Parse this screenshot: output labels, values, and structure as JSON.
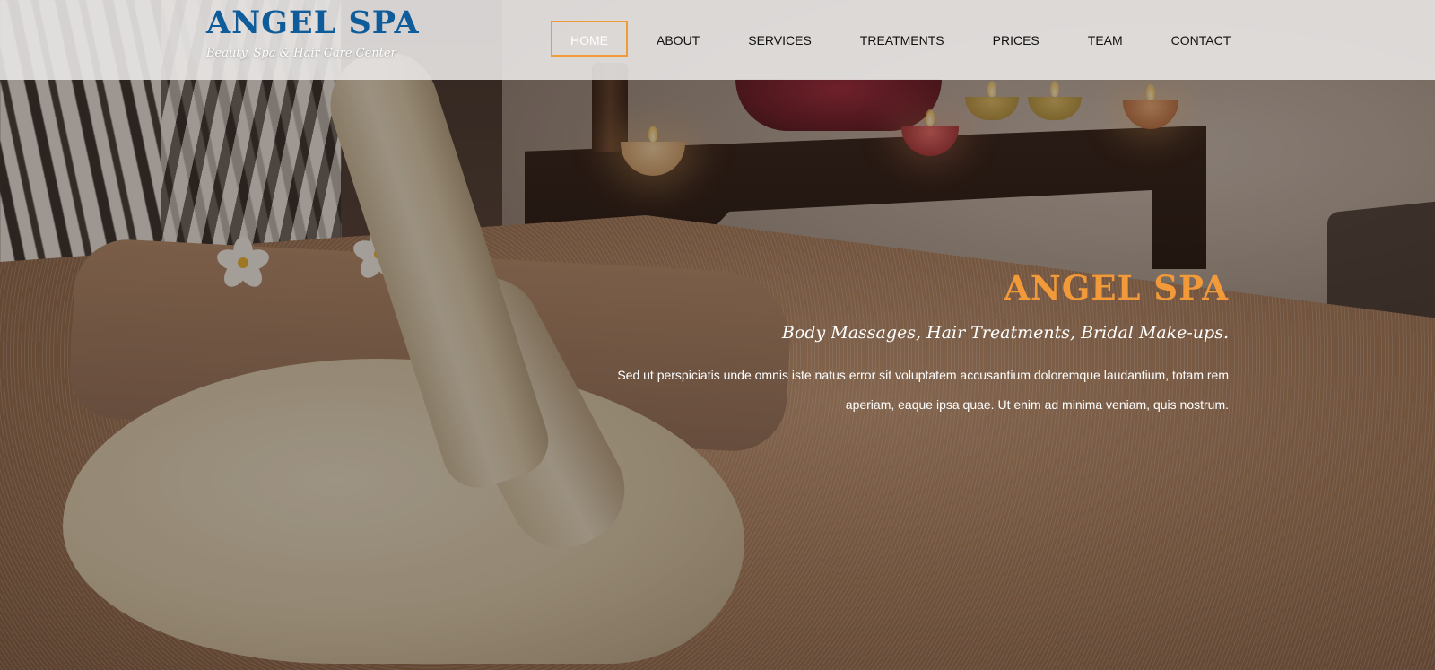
{
  "brand": {
    "title": "ANGEL SPA",
    "subtitle": "Beauty, Spa & Hair Care Center",
    "title_color": "#0f5c9a"
  },
  "nav": {
    "items": [
      {
        "label": "HOME",
        "active": true
      },
      {
        "label": "ABOUT",
        "active": false
      },
      {
        "label": "SERVICES",
        "active": false
      },
      {
        "label": "TREATMENTS",
        "active": false
      },
      {
        "label": "PRICES",
        "active": false
      },
      {
        "label": "TEAM",
        "active": false
      },
      {
        "label": "CONTACT",
        "active": false
      }
    ],
    "active_border_color": "#f29a37"
  },
  "hero": {
    "title": "ANGEL SPA",
    "tagline": "Body Massages, Hair Treatments, Bridal Make-ups.",
    "description": "Sed ut perspiciatis unde omnis iste natus error sit voluptatem accusantium doloremque laudantium, totam rem aperiam, eaque ipsa quae. Ut enim ad minima veniam, quis nostrum.",
    "title_color": "#f2993a",
    "background_image": "spa-towel-swan-photo"
  }
}
